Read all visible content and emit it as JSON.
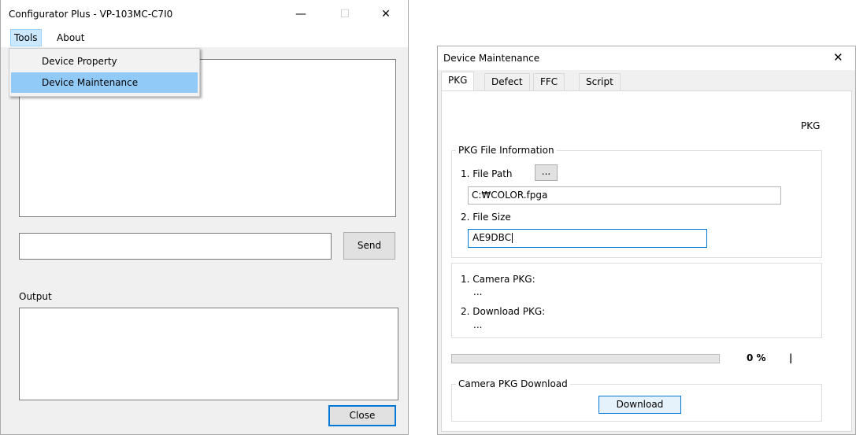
{
  "main_window": {
    "title": "Configurator Plus - VP-103MC-C7I0",
    "controls": {
      "minimize": "—",
      "maximize": "☐",
      "close": "✕"
    },
    "menu": [
      {
        "label": "Tools",
        "active": true
      },
      {
        "label": "About",
        "active": false
      }
    ],
    "tools_dropdown": [
      {
        "label": "Device Property",
        "highlighted": false
      },
      {
        "label": "Device Maintenance",
        "highlighted": true
      }
    ],
    "command_input": {
      "value": ""
    },
    "send_button": "Send",
    "output_label": "Output",
    "close_button": "Close"
  },
  "maintenance_window": {
    "title": "Device Maintenance",
    "close": "✕",
    "tabs": [
      {
        "label": "PKG",
        "selected": true
      },
      {
        "label": "Defect",
        "selected": false
      },
      {
        "label": "FFC",
        "selected": false
      },
      {
        "label": "Script",
        "selected": false
      }
    ],
    "pkg_tab": {
      "heading": "PKG",
      "file_info_group": {
        "title": "PKG File Information",
        "file_path_label": "1. File Path",
        "browse_button": "...",
        "file_path_value": "C:₩COLOR.fpga",
        "file_size_label": "2. File Size",
        "file_size_value": "AE9DBC"
      },
      "version_group": {
        "camera_pkg_label": "1. Camera PKG:",
        "camera_pkg_value": "...",
        "download_pkg_label": "2. Download PKG:",
        "download_pkg_value": "..."
      },
      "progress": {
        "fraction": 0,
        "text": "0 %",
        "marker": "|"
      },
      "download_group": {
        "title": "Camera PKG Download",
        "download_button": "Download"
      }
    }
  },
  "colors": {
    "highlight": "#91c9f7",
    "menu_active": "#cce8ff",
    "focus_border": "#0078d7"
  }
}
